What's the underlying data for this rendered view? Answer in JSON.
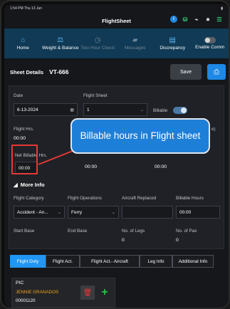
{
  "status": {
    "time": "1:54 PM",
    "date": "Thu 13 Jun",
    "battery": "●"
  },
  "header": {
    "title": "FlightSheet"
  },
  "nav": [
    {
      "label": "Home",
      "icon": "home-icon",
      "enabled": true
    },
    {
      "label": "Weight & Balance",
      "icon": "scale-icon",
      "enabled": true
    },
    {
      "label": "Two Hour Check",
      "icon": "clock-icon",
      "enabled": false
    },
    {
      "label": "Messages",
      "icon": "chat-icon",
      "enabled": false
    },
    {
      "label": "Discrepancy",
      "icon": "clipboard-icon",
      "enabled": true
    },
    {
      "label": "Enable Comm",
      "icon": "toggle-icon",
      "enabled": true
    }
  ],
  "sheet": {
    "details_label": "Sheet Details",
    "aircraft": "VT-666",
    "save_label": "Save"
  },
  "form": {
    "date_label": "Date",
    "date_value": "6-13-2024",
    "flight_sheet_label": "Flight Sheet",
    "flight_sheet_value": "1",
    "billable_label": "Billable",
    "flight_hrs_label": "Flight Hrs.",
    "flight_hrs_value": "00:00",
    "hidden_label_suffix": "e)",
    "net_billable_label": "Net Billable Hrs.",
    "net_billable_value": "00:00",
    "mid_value_1": "00:00",
    "mid_value_2": "00:00",
    "more_info_label": "More Info",
    "flight_category_label": "Flight Category",
    "flight_category_value": "Accident - An...",
    "flight_operations_label": "Flight Operations",
    "flight_operations_value": "Ferry",
    "aircraft_replaced_label": "Aircraft Replaced",
    "billable_hours_label": "Billable Hours",
    "billable_hours_value": "00:00",
    "start_base_label": "Start Base",
    "end_base_label": "End Base",
    "legs_label": "No. of Legs",
    "legs_value": "0",
    "pax_label": "No. of Pax",
    "pax_value": "0"
  },
  "callout": {
    "text": "Billable hours in Flight sheet"
  },
  "tabs": [
    "Flight Duty",
    "Flight Act.",
    "Flight Act.- Aircraft",
    "Leg Info",
    "Additional Info"
  ],
  "pic": {
    "role": "PIC",
    "name": "JENNIE GRANADOS",
    "id": "00001120"
  },
  "colors": {
    "accent": "#2196f3",
    "nav_bg": "#103a55",
    "highlight": "#e53935",
    "name": "#f0a21c"
  }
}
